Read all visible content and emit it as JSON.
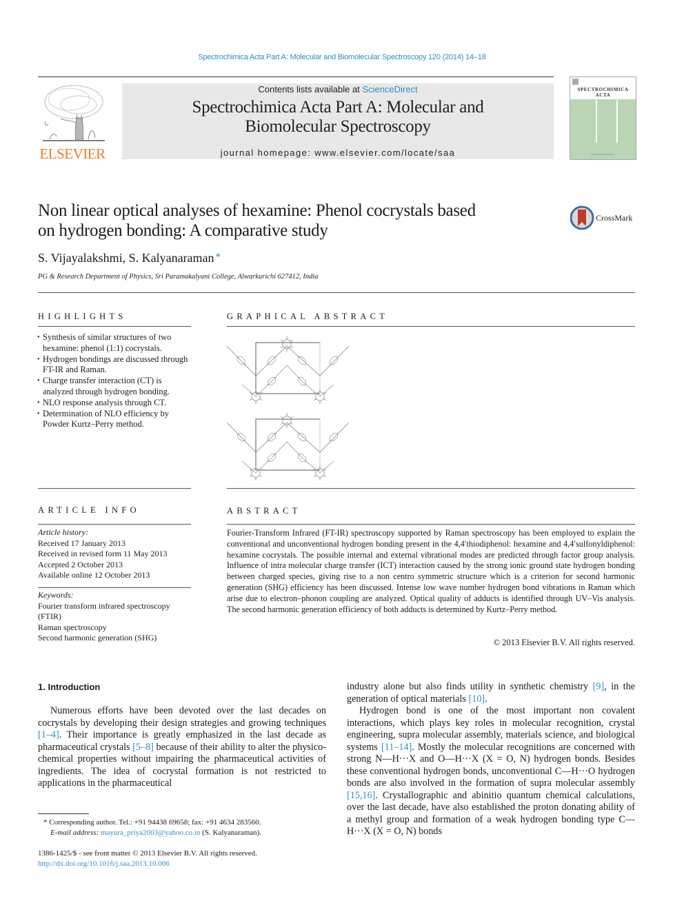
{
  "running_head": "Spectrochimica Acta Part A: Molecular and Biomolecular Spectroscopy 120 (2014) 14–18",
  "publisher": {
    "logo_label": "ELSEVIER",
    "brand_color": "#ef7d22"
  },
  "masthead": {
    "contents_prefix": "Contents lists available at ",
    "contents_link": "ScienceDirect",
    "journal_title_line1": "Spectrochimica Acta Part A: Molecular and",
    "journal_title_line2": "Biomolecular Spectroscopy",
    "homepage_prefix": "journal homepage: ",
    "homepage_url": "www.elsevier.com/locate/saa",
    "background_color": "#e8e8e8"
  },
  "cover": {
    "title_line1": "SPECTROCHIMICA",
    "title_line2": "ACTA",
    "color": "#b9d5b4"
  },
  "article": {
    "title_line1": "Non linear optical analyses of hexamine: Phenol cocrystals based",
    "title_line2": "on hydrogen bonding: A comparative study",
    "crossmark_label": "CrossMark",
    "authors": "S. Vijayalakshmi, S. Kalyanaraman",
    "corresponding_mark": "*",
    "affiliation": "PG & Research Department of Physics, Sri Paramakalyani College, Alwarkurichi 627412, India"
  },
  "highlights": {
    "heading": "HIGHLIGHTS",
    "items": [
      "Synthesis of similar structures of two hexamine: phenol (1:1) cocrystals.",
      "Hydrogen bondings are discussed through FT-IR and Raman.",
      "Charge transfer interaction (CT) is analyzed through hydrogen bonding.",
      "NLO response analysis through CT.",
      "Determination of NLO efficiency by Powder Kurtz–Perry method."
    ]
  },
  "graphical_abstract": {
    "heading": "GRAPHICAL ABSTRACT",
    "figure_description": "Two crystal packing diagrams of hexamine: phenol cocrystals"
  },
  "article_info": {
    "heading": "ARTICLE INFO",
    "history_label": "Article history:",
    "history": [
      "Received 17 January 2013",
      "Received in revised form 11 May 2013",
      "Accepted 2 October 2013",
      "Available online 12 October 2013"
    ],
    "keywords_label": "Keywords:",
    "keywords": [
      "Fourier transform infrared spectroscopy (FTIR)",
      "Raman spectroscopy",
      "Second harmonic generation (SHG)"
    ]
  },
  "abstract": {
    "heading": "ABSTRACT",
    "text": "Fourier-Transform Infrared (FT-IR) spectroscopy supported by Raman spectroscopy has been employed to explain the conventional and unconventional hydrogen bonding present in the 4,4′thiodiphenol: hexamine and 4,4′sulfonyldiphenol: hexamine cocrystals. The possible internal and external vibrational modes are predicted through factor group analysis. Influence of intra molecular charge transfer (ICT) interaction caused by the strong ionic ground state hydrogen bonding between charged species, giving rise to a non centro symmetric structure which is a criterion for second harmonic generation (SHG) efficiency has been discussed. Intense low wave number hydrogen bond vibrations in Raman which arise due to electron–phonon coupling are analyzed. Optical quality of adducts is identified through UV–Vis analysis. The second harmonic generation efficiency of both adducts is determined by Kurtz–Perry method.",
    "copyright": "© 2013 Elsevier B.V. All rights reserved."
  },
  "introduction": {
    "heading": "1. Introduction",
    "p1": {
      "t1": "Numerous efforts have been devoted over the last decades on cocrystals by developing their design strategies and growing techniques ",
      "r1": "[1–4]",
      "t2": ". Their importance is greatly emphasized in the last decade as pharmaceutical crystals ",
      "r2": "[5–8]",
      "t3": " because of their ability to alter the physico-chemical properties without impairing the pharmaceutical activities of ingredients. The idea of cocrystal formation is not restricted to applications in the pharmaceutical industry alone but also finds utility in synthetic chemistry ",
      "r3": "[9]",
      "t4": ", in the generation of optical materials ",
      "r4": "[10]",
      "t5": "."
    },
    "p2": {
      "t1": "Hydrogen bond is one of the most important non covalent interactions, which plays key roles in molecular recognition, crystal engineering, supra molecular assembly, materials science, and biological systems ",
      "r1": "[11–14]",
      "t2": ". Mostly the molecular recognitions are concerned with strong N—H···X and O—H···X (X = O, N) hydrogen bonds. Besides these conventional hydrogen bonds, unconventional C—H···O hydrogen bonds are also involved in the formation of supra molecular assembly ",
      "r2": "[15,16]",
      "t3": ". Crystallographic and abinitio quantum chemical calculations, over the last decade, have also established the proton donating ability of a methyl group and formation of a weak hydrogen bonding type C—H···X (X = O, N) bonds"
    }
  },
  "footnote": {
    "mark": "*",
    "text": "Corresponding author. Tel.: +91 94438 69658; fax: +91 4634 283560.",
    "email_label": "E-mail address:",
    "email": "mayura_priya2003@yahoo.co.in",
    "email_owner": "(S. Kalyanaraman)."
  },
  "front_matter": {
    "issn_line": "1386-1425/$ - see front matter © 2013 Elsevier B.V. All rights reserved.",
    "doi": "http://dx.doi.org/10.1016/j.saa.2013.10.006"
  },
  "link_color": "#2b8fc1"
}
